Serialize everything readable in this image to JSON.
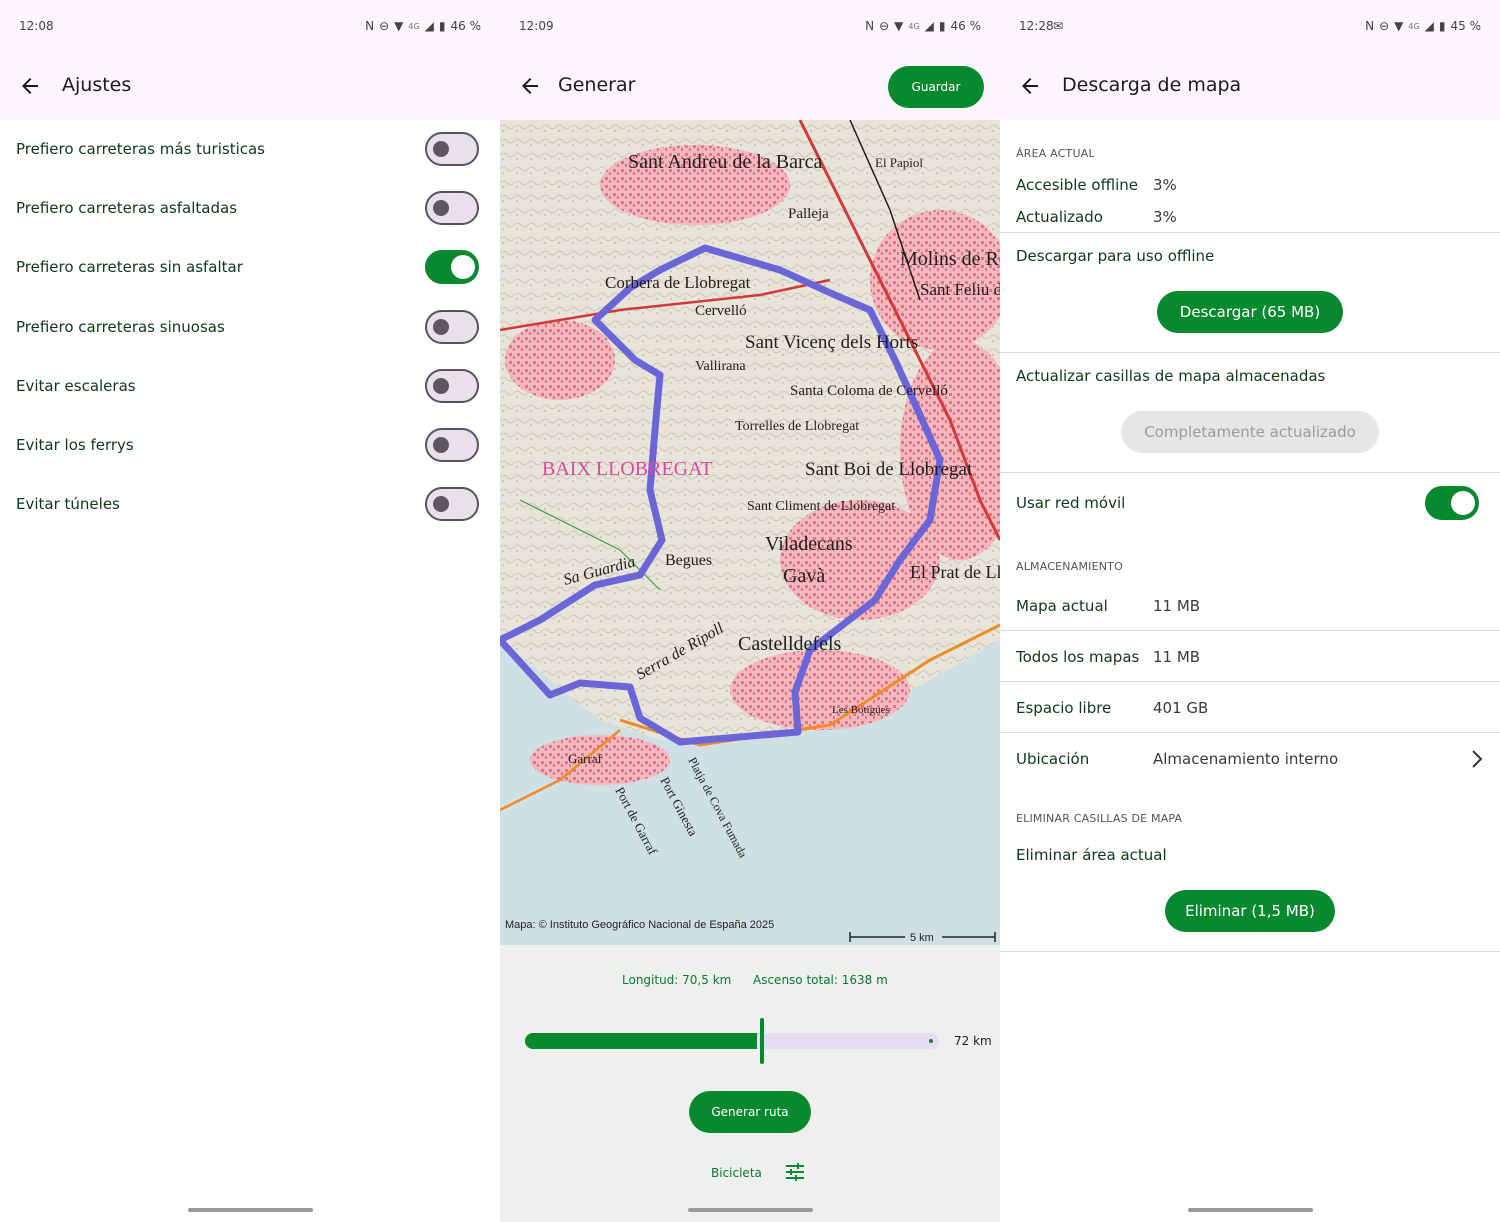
{
  "settings": {
    "status": {
      "time": "12:08",
      "battery": "46 %",
      "network": "4G"
    },
    "title": "Ajustes",
    "items": [
      {
        "label": "Prefiero carreteras más turisticas",
        "on": false
      },
      {
        "label": "Prefiero carreteras asfaltadas",
        "on": false
      },
      {
        "label": "Prefiero carreteras sin asfaltar",
        "on": true
      },
      {
        "label": "Prefiero carreteras sinuosas",
        "on": false
      },
      {
        "label": "Evitar escaleras",
        "on": false
      },
      {
        "label": "Evitar los ferrys",
        "on": false
      },
      {
        "label": "Evitar túneles",
        "on": false
      }
    ]
  },
  "generate": {
    "status": {
      "time": "12:09",
      "battery": "46 %",
      "network": "4G"
    },
    "title": "Generar",
    "save_label": "Guardar",
    "map": {
      "attribution": "Mapa: © Instituto Geográfico Nacional de España 2025",
      "scale": "5 km",
      "labels": [
        "Sant Andreu de la Barca",
        "Palleja",
        "El Papiol",
        "Molins de Rei",
        "Sant Feliu de Llobregat",
        "Corbera de Llobregat",
        "Cervelló",
        "Vallirana",
        "Sant Vicenç dels Horts",
        "Santa Coloma de Cervelló",
        "Torrelles de Llobregat",
        "BAIX LLOBREGAT",
        "Sant Boi de Llobregat",
        "Sant Climent de Llobregat",
        "Viladecans",
        "Begues",
        "Gavà",
        "El Prat de Llobregat",
        "Castelldefels",
        "Garraf",
        "Port Ginesta",
        "Platja de Cova Fumada",
        "Port de Garraf",
        "Les Botigues",
        "Sa Guardia",
        "Serra de Ripoll"
      ]
    },
    "stats": {
      "length": "Longitud: 70,5 km",
      "ascent": "Ascenso total: 1638 m"
    },
    "slider": {
      "value_fraction": 0.56,
      "end_label": "72 km"
    },
    "generate_label": "Generar ruta",
    "mode_label": "Bicicleta"
  },
  "download": {
    "status": {
      "time": "12:28",
      "battery": "45 %",
      "network": "4G"
    },
    "title": "Descarga de mapa",
    "current_area_header": "Área actual",
    "offline_key": "Accesible offline",
    "offline_val": "3%",
    "updated_key": "Actualizado",
    "updated_val": "3%",
    "download_section": "Descargar para uso offline",
    "download_button": "Descargar (65 MB)",
    "update_section": "Actualizar casillas de mapa almacenadas",
    "update_button": "Completamente actualizado",
    "mobile_label": "Usar red móvil",
    "mobile_on": true,
    "storage_header": "Almacenamiento",
    "current_map_key": "Mapa actual",
    "current_map_val": "11 MB",
    "all_maps_key": "Todos los mapas",
    "all_maps_val": "11 MB",
    "free_key": "Espacio libre",
    "free_val": "401 GB",
    "location_key": "Ubicación",
    "location_val": "Almacenamiento interno",
    "delete_header": "Eliminar casillas de mapa",
    "delete_section": "Eliminar área actual",
    "delete_button": "Eliminar (1,5 MB)"
  },
  "colors": {
    "accent": "#08882f",
    "appbar": "#fdf5fc",
    "route": "#6b66d8",
    "toggle_off": "#e9e1ea"
  }
}
